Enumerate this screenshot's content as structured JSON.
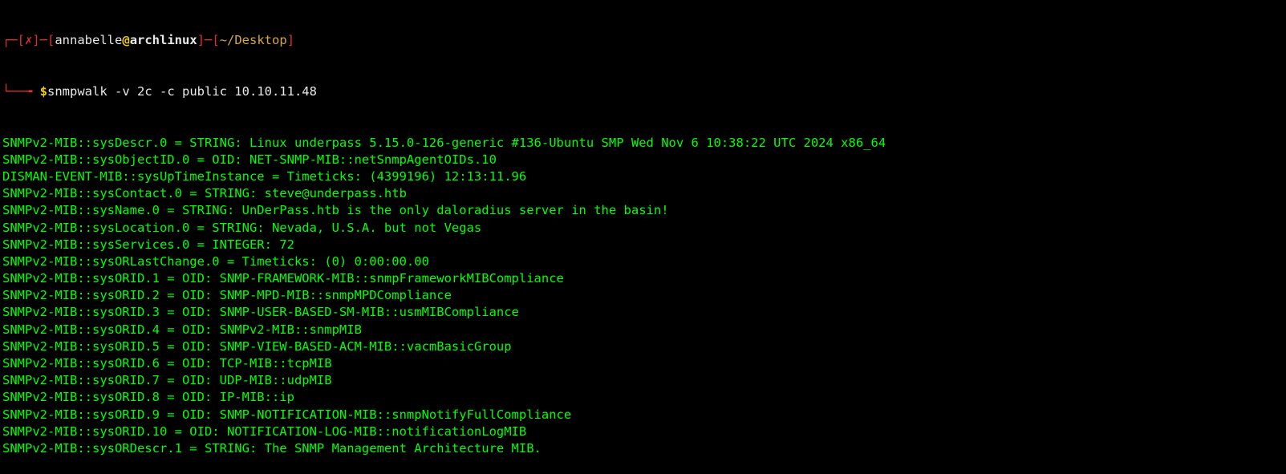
{
  "prompt": {
    "bracket_open": "┌─[",
    "status_mark": "✗",
    "sep1": "]─[",
    "user": "annabelle",
    "at": "@",
    "host": "archlinux",
    "sep2": "]─[",
    "cwd": "~/Desktop",
    "bracket_close": "]",
    "second_line_prefix": "└──╼ ",
    "dollar": "$",
    "command": "snmpwalk -v 2c -c public 10.10.11.48"
  },
  "output_lines": [
    "SNMPv2-MIB::sysDescr.0 = STRING: Linux underpass 5.15.0-126-generic #136-Ubuntu SMP Wed Nov 6 10:38:22 UTC 2024 x86_64",
    "SNMPv2-MIB::sysObjectID.0 = OID: NET-SNMP-MIB::netSnmpAgentOIDs.10",
    "DISMAN-EVENT-MIB::sysUpTimeInstance = Timeticks: (4399196) 12:13:11.96",
    "SNMPv2-MIB::sysContact.0 = STRING: steve@underpass.htb",
    "SNMPv2-MIB::sysName.0 = STRING: UnDerPass.htb is the only daloradius server in the basin!",
    "SNMPv2-MIB::sysLocation.0 = STRING: Nevada, U.S.A. but not Vegas",
    "SNMPv2-MIB::sysServices.0 = INTEGER: 72",
    "SNMPv2-MIB::sysORLastChange.0 = Timeticks: (0) 0:00:00.00",
    "SNMPv2-MIB::sysORID.1 = OID: SNMP-FRAMEWORK-MIB::snmpFrameworkMIBCompliance",
    "SNMPv2-MIB::sysORID.2 = OID: SNMP-MPD-MIB::snmpMPDCompliance",
    "SNMPv2-MIB::sysORID.3 = OID: SNMP-USER-BASED-SM-MIB::usmMIBCompliance",
    "SNMPv2-MIB::sysORID.4 = OID: SNMPv2-MIB::snmpMIB",
    "SNMPv2-MIB::sysORID.5 = OID: SNMP-VIEW-BASED-ACM-MIB::vacmBasicGroup",
    "SNMPv2-MIB::sysORID.6 = OID: TCP-MIB::tcpMIB",
    "SNMPv2-MIB::sysORID.7 = OID: UDP-MIB::udpMIB",
    "SNMPv2-MIB::sysORID.8 = OID: IP-MIB::ip",
    "SNMPv2-MIB::sysORID.9 = OID: SNMP-NOTIFICATION-MIB::snmpNotifyFullCompliance",
    "SNMPv2-MIB::sysORID.10 = OID: NOTIFICATION-LOG-MIB::notificationLogMIB",
    "SNMPv2-MIB::sysORDescr.1 = STRING: The SNMP Management Architecture MIB."
  ],
  "colors": {
    "background": "#000000",
    "output_text": "#00ff00",
    "prompt_frame": "#e0312f",
    "user": "#e8e8e8",
    "host": "#e8e8e8",
    "dollar": "#f4d000"
  }
}
